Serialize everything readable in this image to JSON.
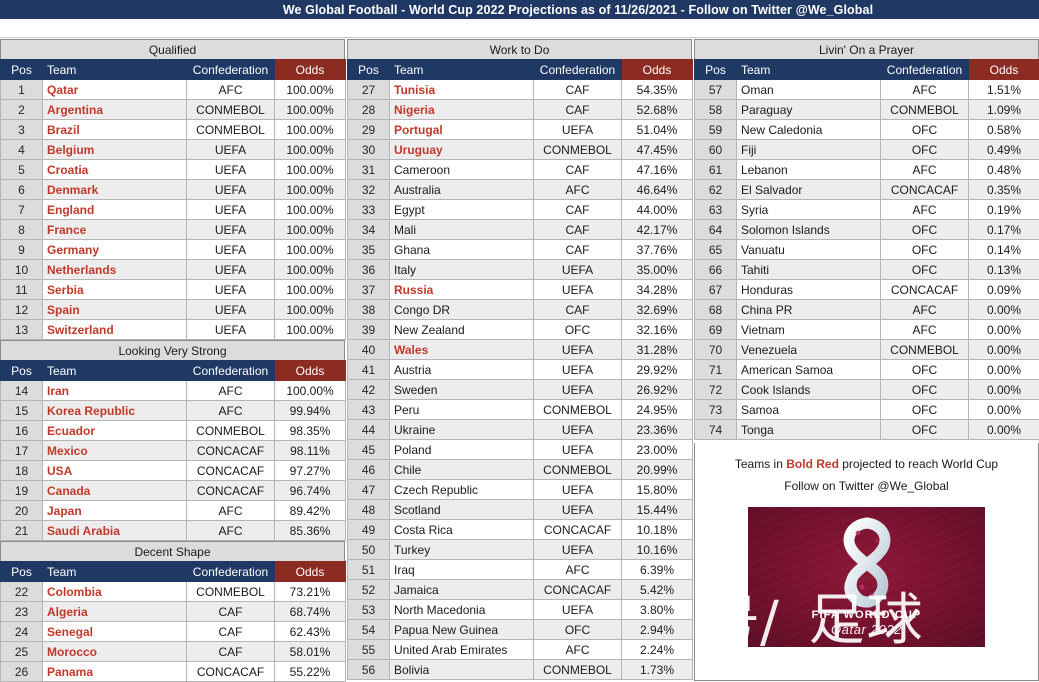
{
  "title_bar": {
    "text": "We Global Football - World Cup 2022 Projections as of 11/26/2021 - Follow on Twitter @We_Global"
  },
  "columns_header": {
    "pos": "Pos",
    "team": "Team",
    "confederation": "Confederation",
    "odds": "Odds"
  },
  "sections": [
    {
      "id": "qualified",
      "title": "Qualified",
      "rows": [
        {
          "pos": "1",
          "team": "Qatar",
          "conf": "AFC",
          "odds": "100.00%",
          "bold_red": true
        },
        {
          "pos": "2",
          "team": "Argentina",
          "conf": "CONMEBOL",
          "odds": "100.00%",
          "bold_red": true
        },
        {
          "pos": "3",
          "team": "Brazil",
          "conf": "CONMEBOL",
          "odds": "100.00%",
          "bold_red": true
        },
        {
          "pos": "4",
          "team": "Belgium",
          "conf": "UEFA",
          "odds": "100.00%",
          "bold_red": true
        },
        {
          "pos": "5",
          "team": "Croatia",
          "conf": "UEFA",
          "odds": "100.00%",
          "bold_red": true
        },
        {
          "pos": "6",
          "team": "Denmark",
          "conf": "UEFA",
          "odds": "100.00%",
          "bold_red": true
        },
        {
          "pos": "7",
          "team": "England",
          "conf": "UEFA",
          "odds": "100.00%",
          "bold_red": true
        },
        {
          "pos": "8",
          "team": "France",
          "conf": "UEFA",
          "odds": "100.00%",
          "bold_red": true
        },
        {
          "pos": "9",
          "team": "Germany",
          "conf": "UEFA",
          "odds": "100.00%",
          "bold_red": true
        },
        {
          "pos": "10",
          "team": "Netherlands",
          "conf": "UEFA",
          "odds": "100.00%",
          "bold_red": true
        },
        {
          "pos": "11",
          "team": "Serbia",
          "conf": "UEFA",
          "odds": "100.00%",
          "bold_red": true
        },
        {
          "pos": "12",
          "team": "Spain",
          "conf": "UEFA",
          "odds": "100.00%",
          "bold_red": true
        },
        {
          "pos": "13",
          "team": "Switzerland",
          "conf": "UEFA",
          "odds": "100.00%",
          "bold_red": true
        }
      ]
    },
    {
      "id": "looking-very-strong",
      "title": "Looking Very Strong",
      "rows": [
        {
          "pos": "14",
          "team": "Iran",
          "conf": "AFC",
          "odds": "100.00%",
          "bold_red": true
        },
        {
          "pos": "15",
          "team": "Korea Republic",
          "conf": "AFC",
          "odds": "99.94%",
          "bold_red": true
        },
        {
          "pos": "16",
          "team": "Ecuador",
          "conf": "CONMEBOL",
          "odds": "98.35%",
          "bold_red": true
        },
        {
          "pos": "17",
          "team": "Mexico",
          "conf": "CONCACAF",
          "odds": "98.11%",
          "bold_red": true
        },
        {
          "pos": "18",
          "team": "USA",
          "conf": "CONCACAF",
          "odds": "97.27%",
          "bold_red": true
        },
        {
          "pos": "19",
          "team": "Canada",
          "conf": "CONCACAF",
          "odds": "96.74%",
          "bold_red": true
        },
        {
          "pos": "20",
          "team": "Japan",
          "conf": "AFC",
          "odds": "89.42%",
          "bold_red": true
        },
        {
          "pos": "21",
          "team": "Saudi Arabia",
          "conf": "AFC",
          "odds": "85.36%",
          "bold_red": true
        }
      ]
    },
    {
      "id": "decent-shape",
      "title": "Decent Shape",
      "rows": [
        {
          "pos": "22",
          "team": "Colombia",
          "conf": "CONMEBOL",
          "odds": "73.21%",
          "bold_red": true
        },
        {
          "pos": "23",
          "team": "Algeria",
          "conf": "CAF",
          "odds": "68.74%",
          "bold_red": true
        },
        {
          "pos": "24",
          "team": "Senegal",
          "conf": "CAF",
          "odds": "62.43%",
          "bold_red": true
        },
        {
          "pos": "25",
          "team": "Morocco",
          "conf": "CAF",
          "odds": "58.01%",
          "bold_red": true
        },
        {
          "pos": "26",
          "team": "Panama",
          "conf": "CONCACAF",
          "odds": "55.22%",
          "bold_red": true
        }
      ]
    },
    {
      "id": "work-to-do",
      "title": "Work to Do",
      "rows": [
        {
          "pos": "27",
          "team": "Tunisia",
          "conf": "CAF",
          "odds": "54.35%",
          "bold_red": true
        },
        {
          "pos": "28",
          "team": "Nigeria",
          "conf": "CAF",
          "odds": "52.68%",
          "bold_red": true
        },
        {
          "pos": "29",
          "team": "Portugal",
          "conf": "UEFA",
          "odds": "51.04%",
          "bold_red": true
        },
        {
          "pos": "30",
          "team": "Uruguay",
          "conf": "CONMEBOL",
          "odds": "47.45%",
          "bold_red": true
        },
        {
          "pos": "31",
          "team": "Cameroon",
          "conf": "CAF",
          "odds": "47.16%",
          "bold_red": false
        },
        {
          "pos": "32",
          "team": "Australia",
          "conf": "AFC",
          "odds": "46.64%",
          "bold_red": false
        },
        {
          "pos": "33",
          "team": "Egypt",
          "conf": "CAF",
          "odds": "44.00%",
          "bold_red": false
        },
        {
          "pos": "34",
          "team": "Mali",
          "conf": "CAF",
          "odds": "42.17%",
          "bold_red": false
        },
        {
          "pos": "35",
          "team": "Ghana",
          "conf": "CAF",
          "odds": "37.76%",
          "bold_red": false
        },
        {
          "pos": "36",
          "team": "Italy",
          "conf": "UEFA",
          "odds": "35.00%",
          "bold_red": false
        },
        {
          "pos": "37",
          "team": "Russia",
          "conf": "UEFA",
          "odds": "34.28%",
          "bold_red": true
        },
        {
          "pos": "38",
          "team": "Congo DR",
          "conf": "CAF",
          "odds": "32.69%",
          "bold_red": false
        },
        {
          "pos": "39",
          "team": "New Zealand",
          "conf": "OFC",
          "odds": "32.16%",
          "bold_red": false
        },
        {
          "pos": "40",
          "team": "Wales",
          "conf": "UEFA",
          "odds": "31.28%",
          "bold_red": true
        },
        {
          "pos": "41",
          "team": "Austria",
          "conf": "UEFA",
          "odds": "29.92%",
          "bold_red": false
        },
        {
          "pos": "42",
          "team": "Sweden",
          "conf": "UEFA",
          "odds": "26.92%",
          "bold_red": false
        },
        {
          "pos": "43",
          "team": "Peru",
          "conf": "CONMEBOL",
          "odds": "24.95%",
          "bold_red": false
        },
        {
          "pos": "44",
          "team": "Ukraine",
          "conf": "UEFA",
          "odds": "23.36%",
          "bold_red": false
        },
        {
          "pos": "45",
          "team": "Poland",
          "conf": "UEFA",
          "odds": "23.00%",
          "bold_red": false
        },
        {
          "pos": "46",
          "team": "Chile",
          "conf": "CONMEBOL",
          "odds": "20.99%",
          "bold_red": false
        },
        {
          "pos": "47",
          "team": "Czech Republic",
          "conf": "UEFA",
          "odds": "15.80%",
          "bold_red": false
        },
        {
          "pos": "48",
          "team": "Scotland",
          "conf": "UEFA",
          "odds": "15.44%",
          "bold_red": false
        },
        {
          "pos": "49",
          "team": "Costa Rica",
          "conf": "CONCACAF",
          "odds": "10.18%",
          "bold_red": false
        },
        {
          "pos": "50",
          "team": "Turkey",
          "conf": "UEFA",
          "odds": "10.16%",
          "bold_red": false
        },
        {
          "pos": "51",
          "team": "Iraq",
          "conf": "AFC",
          "odds": "6.39%",
          "bold_red": false
        },
        {
          "pos": "52",
          "team": "Jamaica",
          "conf": "CONCACAF",
          "odds": "5.42%",
          "bold_red": false
        },
        {
          "pos": "53",
          "team": "North Macedonia",
          "conf": "UEFA",
          "odds": "3.80%",
          "bold_red": false
        },
        {
          "pos": "54",
          "team": "Papua New Guinea",
          "conf": "OFC",
          "odds": "2.94%",
          "bold_red": false
        },
        {
          "pos": "55",
          "team": "United Arab Emirates",
          "conf": "AFC",
          "odds": "2.24%",
          "bold_red": false
        },
        {
          "pos": "56",
          "team": "Bolivia",
          "conf": "CONMEBOL",
          "odds": "1.73%",
          "bold_red": false
        }
      ]
    },
    {
      "id": "livin-on-a-prayer",
      "title": "Livin' On a Prayer",
      "rows": [
        {
          "pos": "57",
          "team": "Oman",
          "conf": "AFC",
          "odds": "1.51%",
          "bold_red": false
        },
        {
          "pos": "58",
          "team": "Paraguay",
          "conf": "CONMEBOL",
          "odds": "1.09%",
          "bold_red": false
        },
        {
          "pos": "59",
          "team": "New Caledonia",
          "conf": "OFC",
          "odds": "0.58%",
          "bold_red": false
        },
        {
          "pos": "60",
          "team": "Fiji",
          "conf": "OFC",
          "odds": "0.49%",
          "bold_red": false
        },
        {
          "pos": "61",
          "team": "Lebanon",
          "conf": "AFC",
          "odds": "0.48%",
          "bold_red": false
        },
        {
          "pos": "62",
          "team": "El Salvador",
          "conf": "CONCACAF",
          "odds": "0.35%",
          "bold_red": false
        },
        {
          "pos": "63",
          "team": "Syria",
          "conf": "AFC",
          "odds": "0.19%",
          "bold_red": false
        },
        {
          "pos": "64",
          "team": "Solomon Islands",
          "conf": "OFC",
          "odds": "0.17%",
          "bold_red": false
        },
        {
          "pos": "65",
          "team": "Vanuatu",
          "conf": "OFC",
          "odds": "0.14%",
          "bold_red": false
        },
        {
          "pos": "66",
          "team": "Tahiti",
          "conf": "OFC",
          "odds": "0.13%",
          "bold_red": false
        },
        {
          "pos": "67",
          "team": "Honduras",
          "conf": "CONCACAF",
          "odds": "0.09%",
          "bold_red": false
        },
        {
          "pos": "68",
          "team": "China PR",
          "conf": "AFC",
          "odds": "0.00%",
          "bold_red": false
        },
        {
          "pos": "69",
          "team": "Vietnam",
          "conf": "AFC",
          "odds": "0.00%",
          "bold_red": false
        },
        {
          "pos": "70",
          "team": "Venezuela",
          "conf": "CONMEBOL",
          "odds": "0.00%",
          "bold_red": false
        },
        {
          "pos": "71",
          "team": "American Samoa",
          "conf": "OFC",
          "odds": "0.00%",
          "bold_red": false
        },
        {
          "pos": "72",
          "team": "Cook Islands",
          "conf": "OFC",
          "odds": "0.00%",
          "bold_red": false
        },
        {
          "pos": "73",
          "team": "Samoa",
          "conf": "OFC",
          "odds": "0.00%",
          "bold_red": false
        },
        {
          "pos": "74",
          "team": "Tonga",
          "conf": "OFC",
          "odds": "0.00%",
          "bold_red": false
        }
      ]
    }
  ],
  "note": {
    "line1_prefix": "Teams in ",
    "line1_highlight": "Bold Red",
    "line1_suffix": " projected to reach World Cup",
    "line2": "Follow on Twitter @We_Global"
  },
  "poster": {
    "fifa_text": "FIFA WORLD CUP",
    "qatar_text": "Qatar 2022",
    "watermark_left": "号/",
    "watermark_right": "足球"
  },
  "colors": {
    "header_navy": "#1F3864",
    "odds_header_red": "#8C2B22",
    "bold_red": "#C0392B",
    "banner_gray": "#DCDCDC",
    "alt_row": "#EDEDED"
  }
}
